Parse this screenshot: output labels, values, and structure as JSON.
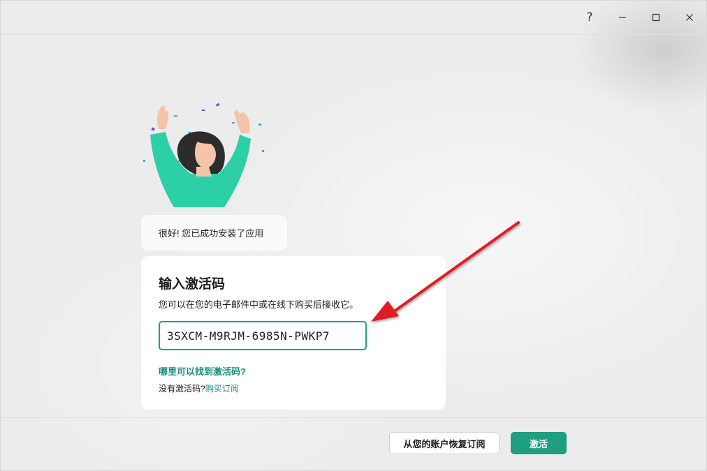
{
  "titlebar": {
    "help_glyph": "?",
    "minimize_icon": "minimize-icon",
    "maximize_icon": "maximize-icon",
    "close_icon": "close-icon"
  },
  "success_message": "很好! 您已成功安装了应用",
  "activation": {
    "title": "输入激活码",
    "subtitle": "您可以在您的电子邮件中或在线下购买后接收它。",
    "code_value": "3SXCM-M9RJM-6985N-PWKP7",
    "find_code_link": "哪里可以找到激活码?",
    "no_code_text": "没有激活码?",
    "buy_link": "购买订阅"
  },
  "footer": {
    "restore_button": "从您的账户恢复订阅",
    "activate_button": "激活"
  },
  "colors": {
    "accent": "#1f9e82",
    "link": "#148c78",
    "annotation_arrow": "#e01b24"
  }
}
